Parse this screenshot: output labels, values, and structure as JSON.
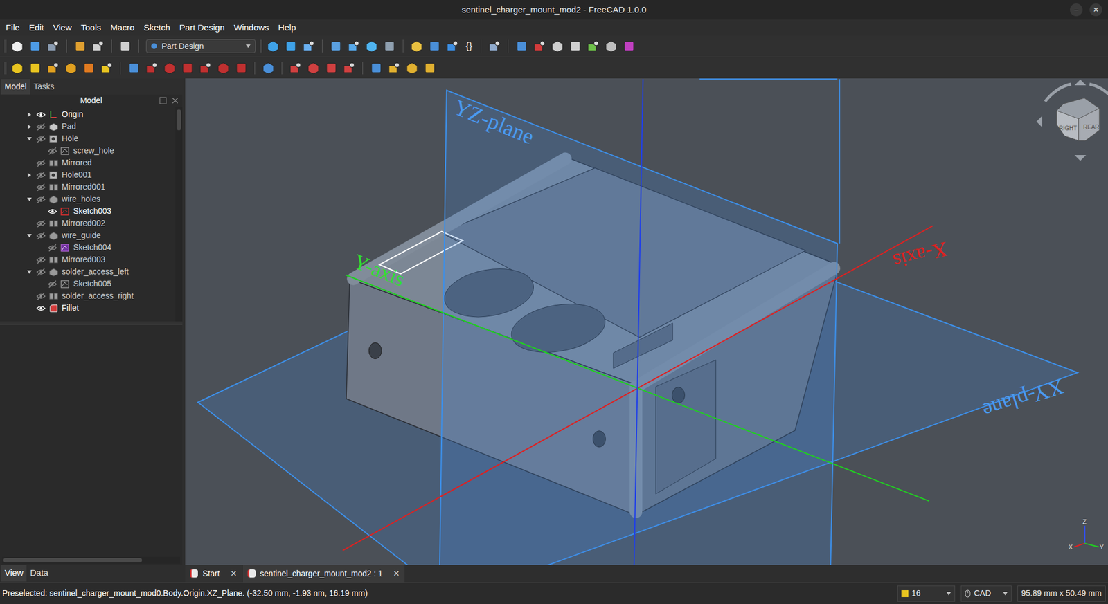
{
  "window": {
    "title": "sentinel_charger_mount_mod2 - FreeCAD 1.0.0",
    "controls": [
      "–",
      "✕"
    ]
  },
  "menu": [
    "File",
    "Edit",
    "View",
    "Tools",
    "Macro",
    "Sketch",
    "Part Design",
    "Windows",
    "Help"
  ],
  "workbench": {
    "value": "Part Design"
  },
  "toolbar": {
    "code_button": "{}"
  },
  "left_panel": {
    "tabs": [
      {
        "label": "Model",
        "selected": true
      },
      {
        "label": "Tasks",
        "selected": false
      }
    ],
    "header": "Model",
    "tree": [
      {
        "label": "Origin",
        "depth": 0,
        "expandable": true,
        "expanded": false,
        "visible": true,
        "kind": "origin"
      },
      {
        "label": "Pad",
        "depth": 0,
        "expandable": true,
        "expanded": false,
        "visible": false,
        "kind": "pad"
      },
      {
        "label": "Hole",
        "depth": 0,
        "expandable": true,
        "expanded": true,
        "visible": false,
        "kind": "hole"
      },
      {
        "label": "screw_hole",
        "depth": 1,
        "expandable": false,
        "expanded": false,
        "visible": false,
        "kind": "sketch"
      },
      {
        "label": "Mirrored",
        "depth": 0,
        "expandable": false,
        "expanded": false,
        "visible": false,
        "kind": "mirrored"
      },
      {
        "label": "Hole001",
        "depth": 0,
        "expandable": true,
        "expanded": false,
        "visible": false,
        "kind": "hole"
      },
      {
        "label": "Mirrored001",
        "depth": 0,
        "expandable": false,
        "expanded": false,
        "visible": false,
        "kind": "mirrored"
      },
      {
        "label": "wire_holes",
        "depth": 0,
        "expandable": true,
        "expanded": true,
        "visible": false,
        "kind": "pocket"
      },
      {
        "label": "Sketch003",
        "depth": 1,
        "expandable": false,
        "expanded": false,
        "visible": true,
        "kind": "sketch-error"
      },
      {
        "label": "Mirrored002",
        "depth": 0,
        "expandable": false,
        "expanded": false,
        "visible": false,
        "kind": "mirrored"
      },
      {
        "label": "wire_guide",
        "depth": 0,
        "expandable": true,
        "expanded": true,
        "visible": false,
        "kind": "pocket"
      },
      {
        "label": "Sketch004",
        "depth": 1,
        "expandable": false,
        "expanded": false,
        "visible": false,
        "kind": "sketch-attached"
      },
      {
        "label": "Mirrored003",
        "depth": 0,
        "expandable": false,
        "expanded": false,
        "visible": false,
        "kind": "mirrored"
      },
      {
        "label": "solder_access_left",
        "depth": 0,
        "expandable": true,
        "expanded": true,
        "visible": false,
        "kind": "pocket"
      },
      {
        "label": "Sketch005",
        "depth": 1,
        "expandable": false,
        "expanded": false,
        "visible": false,
        "kind": "sketch"
      },
      {
        "label": "solder_access_right",
        "depth": 0,
        "expandable": false,
        "expanded": false,
        "visible": false,
        "kind": "mirrored"
      },
      {
        "label": "Fillet",
        "depth": 0,
        "expandable": false,
        "expanded": false,
        "visible": true,
        "kind": "fillet"
      }
    ],
    "bottom_tabs": [
      {
        "label": "View",
        "selected": true
      },
      {
        "label": "Data",
        "selected": false
      }
    ]
  },
  "viewport": {
    "labels": {
      "yz_plane": "YZ-plane",
      "xy_plane": "XY-plane",
      "y_axis": "Y-axis",
      "x_axis": "X-axis"
    },
    "nav_cube": [
      "RIGHT",
      "REAR"
    ],
    "triad": [
      "Z",
      "X",
      "Y"
    ]
  },
  "document_tabs": [
    {
      "label": "Start",
      "selected": false,
      "close": "✕"
    },
    {
      "label": "sentinel_charger_mount_mod2 : 1",
      "selected": true,
      "close": "✕"
    }
  ],
  "status_bar": {
    "message": "Preselected: sentinel_charger_mount_mod0.Body.Origin.XZ_Plane. (-32.50 mm, -1.93 nm, 16.19 mm)",
    "draw_style": "16",
    "navigation": "CAD",
    "dimensions": "95.89 mm x 50.49 mm"
  }
}
